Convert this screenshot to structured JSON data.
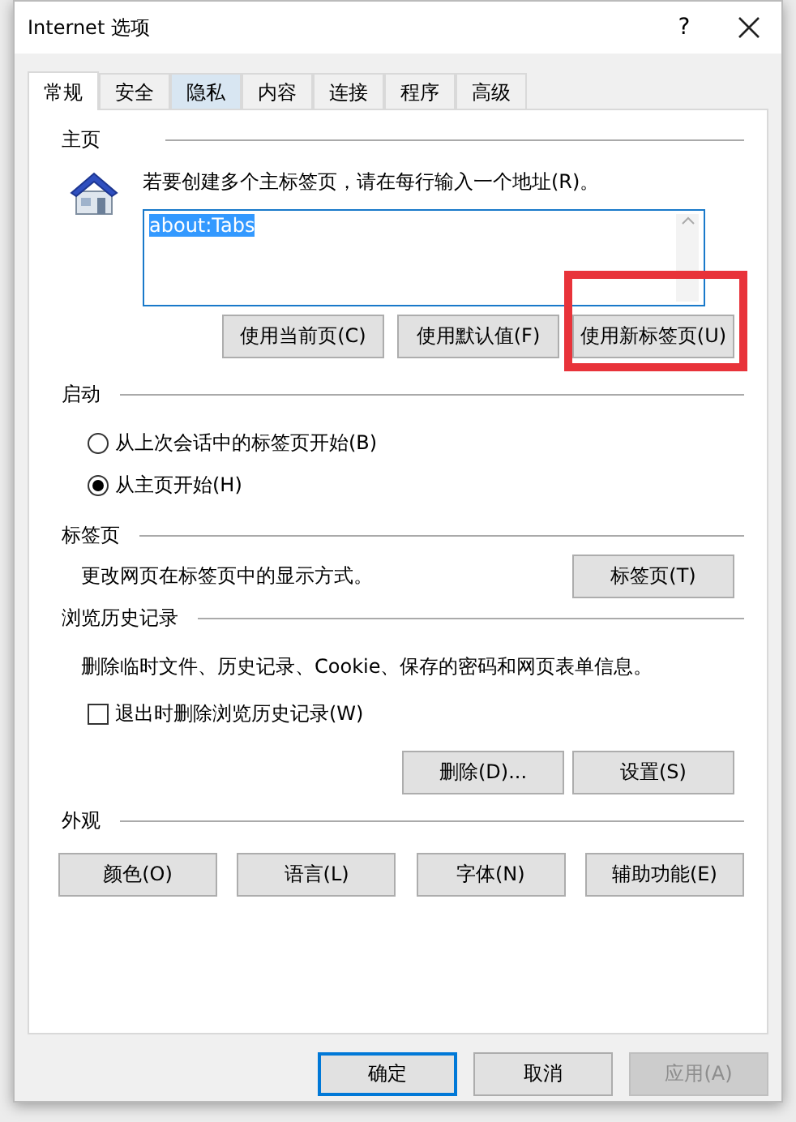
{
  "window": {
    "title": "Internet 选项",
    "help": "?"
  },
  "tabs": [
    {
      "label": "常规",
      "selected": true,
      "hovered": false
    },
    {
      "label": "安全",
      "selected": false,
      "hovered": false
    },
    {
      "label": "隐私",
      "selected": false,
      "hovered": true
    },
    {
      "label": "内容",
      "selected": false,
      "hovered": false
    },
    {
      "label": "连接",
      "selected": false,
      "hovered": false
    },
    {
      "label": "程序",
      "selected": false,
      "hovered": false
    },
    {
      "label": "高级",
      "selected": false,
      "hovered": false
    }
  ],
  "home_page": {
    "heading": "主页",
    "instruction": "若要创建多个主标签页，请在每行输入一个地址(R)。",
    "address": {
      "value": "about:Tabs",
      "selected": true
    },
    "buttons": [
      {
        "label": "使用当前页(C)",
        "highlighted": false
      },
      {
        "label": "使用默认值(F)",
        "highlighted": false
      },
      {
        "label": "使用新标签页(U)",
        "highlighted": true
      }
    ]
  },
  "startup": {
    "heading": "启动",
    "options": [
      {
        "label": "从上次会话中的标签页开始(B)",
        "selected": false
      },
      {
        "label": "从主页开始(H)",
        "selected": true
      }
    ]
  },
  "tabs_section": {
    "heading": "标签页",
    "description": "更改网页在标签页中的显示方式。",
    "button": "标签页(T)"
  },
  "history": {
    "heading": "浏览历史记录",
    "description": "删除临时文件、历史记录、Cookie、保存的密码和网页表单信息。",
    "checkbox": {
      "label": "退出时删除浏览历史记录(W)",
      "checked": false
    },
    "buttons": [
      "删除(D)...",
      "设置(S)"
    ]
  },
  "appearance": {
    "heading": "外观",
    "buttons": [
      "颜色(O)",
      "语言(L)",
      "字体(N)",
      "辅助功能(E)"
    ]
  },
  "footer_buttons": [
    {
      "label": "确定",
      "default": true,
      "disabled": false
    },
    {
      "label": "取消",
      "default": false,
      "disabled": false
    },
    {
      "label": "应用(A)",
      "default": false,
      "disabled": true
    }
  ]
}
